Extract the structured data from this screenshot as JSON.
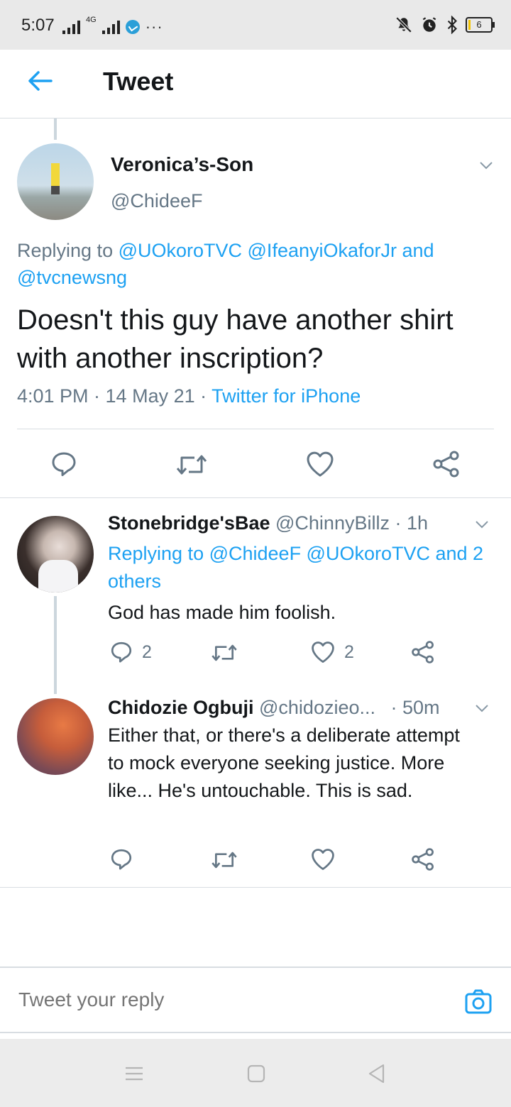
{
  "status_bar": {
    "time": "5:07",
    "network": "4G",
    "battery": "6"
  },
  "header": {
    "title": "Tweet"
  },
  "main_tweet": {
    "name": "Veronica’s-Son",
    "handle": "@ChideeF",
    "replying_prefix": "Replying to ",
    "replying_users": "@UOkoroTVC @IfeanyiOkaforJr and @tvcnewsng",
    "text": "Doesn't this guy have another shirt with another inscription?",
    "time": "4:01 PM · 14 May 21 · ",
    "source": "Twitter for iPhone"
  },
  "replies": [
    {
      "name": "Stonebridge'sBae",
      "handle": "@ChinnyBillz",
      "time": "· 1h",
      "replying_prefix": "Replying to ",
      "replying_users": "@ChideeF @UOkoroTVC and 2 others",
      "text": "God has made him foolish.",
      "reply_count": "2",
      "like_count": "2"
    },
    {
      "name": "Chidozie Ogbuji",
      "handle": "@chidozieo...",
      "time": "· 50m",
      "text": "Either that, or there's a deliberate attempt to mock everyone seeking justice. More like... He's untouchable. This is sad.",
      "reply_count": "",
      "like_count": ""
    }
  ],
  "reply_bar": {
    "placeholder": "Tweet your reply"
  },
  "colors": {
    "accent": "#1da1f2",
    "muted": "#657786",
    "text": "#14171a",
    "divider": "#d8dde2"
  }
}
